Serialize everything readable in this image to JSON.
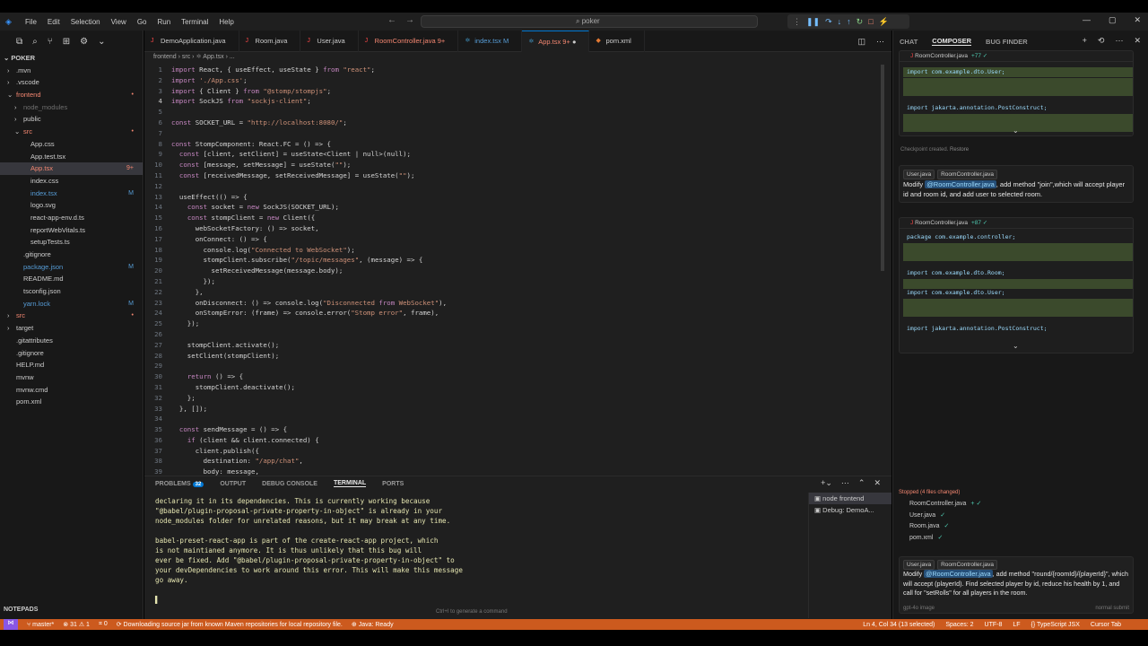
{
  "menu": [
    "File",
    "Edit",
    "Selection",
    "View",
    "Go",
    "Run",
    "Terminal",
    "Help"
  ],
  "search": {
    "value": "poker"
  },
  "explorer": {
    "root": "POKER",
    "items": [
      {
        "label": ".mvn",
        "indent": 1,
        "arrow": "›",
        "color": "#cccccc",
        "dec": ""
      },
      {
        "label": ".vscode",
        "indent": 1,
        "arrow": "›",
        "color": "#cccccc",
        "dec": ""
      },
      {
        "label": "frontend",
        "indent": 1,
        "arrow": "⌄",
        "color": "#f48771",
        "dec": "•"
      },
      {
        "label": "node_modules",
        "indent": 2,
        "arrow": "›",
        "color": "#6e6e6e",
        "dec": ""
      },
      {
        "label": "public",
        "indent": 2,
        "arrow": "›",
        "color": "#cccccc",
        "dec": ""
      },
      {
        "label": "src",
        "indent": 2,
        "arrow": "⌄",
        "color": "#f48771",
        "dec": "•"
      },
      {
        "label": "App.css",
        "indent": 3,
        "arrow": "",
        "color": "#cccccc",
        "dec": ""
      },
      {
        "label": "App.test.tsx",
        "indent": 3,
        "arrow": "",
        "color": "#cccccc",
        "dec": ""
      },
      {
        "label": "App.tsx",
        "indent": 3,
        "arrow": "",
        "color": "#f48771",
        "dec": "9+",
        "sel": true
      },
      {
        "label": "index.css",
        "indent": 3,
        "arrow": "",
        "color": "#cccccc",
        "dec": ""
      },
      {
        "label": "index.tsx",
        "indent": 3,
        "arrow": "",
        "color": "#569cd6",
        "dec": "M"
      },
      {
        "label": "logo.svg",
        "indent": 3,
        "arrow": "",
        "color": "#cccccc",
        "dec": ""
      },
      {
        "label": "react-app-env.d.ts",
        "indent": 3,
        "arrow": "",
        "color": "#cccccc",
        "dec": ""
      },
      {
        "label": "reportWebVitals.ts",
        "indent": 3,
        "arrow": "",
        "color": "#cccccc",
        "dec": ""
      },
      {
        "label": "setupTests.ts",
        "indent": 3,
        "arrow": "",
        "color": "#cccccc",
        "dec": ""
      },
      {
        "label": ".gitignore",
        "indent": 2,
        "arrow": "",
        "color": "#cccccc",
        "dec": ""
      },
      {
        "label": "package.json",
        "indent": 2,
        "arrow": "",
        "color": "#569cd6",
        "dec": "M"
      },
      {
        "label": "README.md",
        "indent": 2,
        "arrow": "",
        "color": "#cccccc",
        "dec": ""
      },
      {
        "label": "tsconfig.json",
        "indent": 2,
        "arrow": "",
        "color": "#cccccc",
        "dec": ""
      },
      {
        "label": "yarn.lock",
        "indent": 2,
        "arrow": "",
        "color": "#569cd6",
        "dec": "M"
      },
      {
        "label": "src",
        "indent": 1,
        "arrow": "›",
        "color": "#f48771",
        "dec": "•"
      },
      {
        "label": "target",
        "indent": 1,
        "arrow": "›",
        "color": "#cccccc",
        "dec": ""
      },
      {
        "label": ".gitattributes",
        "indent": 1,
        "arrow": "",
        "color": "#cccccc",
        "dec": ""
      },
      {
        "label": ".gitignore",
        "indent": 1,
        "arrow": "",
        "color": "#cccccc",
        "dec": ""
      },
      {
        "label": "HELP.md",
        "indent": 1,
        "arrow": "",
        "color": "#cccccc",
        "dec": ""
      },
      {
        "label": "mvnw",
        "indent": 1,
        "arrow": "",
        "color": "#cccccc",
        "dec": ""
      },
      {
        "label": "mvnw.cmd",
        "indent": 1,
        "arrow": "",
        "color": "#cccccc",
        "dec": ""
      },
      {
        "label": "pom.xml",
        "indent": 1,
        "arrow": "",
        "color": "#cccccc",
        "dec": ""
      }
    ],
    "notepads": "NOTEPADS"
  },
  "tabs": [
    {
      "label": "DemoApplication.java",
      "color": "#cccccc",
      "icon": "J",
      "iconColor": "#f44747",
      "active": false
    },
    {
      "label": "Room.java",
      "color": "#cccccc",
      "icon": "J",
      "iconColor": "#f44747",
      "active": false
    },
    {
      "label": "User.java",
      "color": "#cccccc",
      "icon": "J",
      "iconColor": "#f44747",
      "active": false
    },
    {
      "label": "RoomController.java 9+",
      "color": "#f48771",
      "icon": "J",
      "iconColor": "#f44747",
      "active": false
    },
    {
      "label": "index.tsx M",
      "color": "#569cd6",
      "icon": "⚛",
      "iconColor": "#4fc1ff",
      "active": false
    },
    {
      "label": "App.tsx 9+",
      "color": "#f48771",
      "icon": "⚛",
      "iconColor": "#4fc1ff",
      "active": true
    },
    {
      "label": "pom.xml",
      "color": "#cccccc",
      "icon": "◆",
      "iconColor": "#e37933",
      "active": false
    }
  ],
  "breadcrumb": "frontend  ›  src  ›  ⚛ App.tsx  ›  ...",
  "code": [
    {
      "n": "1",
      "t": "import React, { useEffect, useState } from \"react\";"
    },
    {
      "n": "2",
      "t": "import './App.css';"
    },
    {
      "n": "3",
      "t": "import { Client } from \"@stomp/stompjs\";"
    },
    {
      "n": "4",
      "t": "import SockJS from \"sockjs-client\";",
      "cur": true
    },
    {
      "n": "5",
      "t": ""
    },
    {
      "n": "6",
      "t": "const SOCKET_URL = \"http://localhost:8080/\";"
    },
    {
      "n": "7",
      "t": ""
    },
    {
      "n": "8",
      "t": "const StompComponent: React.FC = () => {"
    },
    {
      "n": "9",
      "t": "  const [client, setClient] = useState<Client | null>(null);"
    },
    {
      "n": "10",
      "t": "  const [message, setMessage] = useState(\"\");"
    },
    {
      "n": "11",
      "t": "  const [receivedMessage, setReceivedMessage] = useState(\"\");"
    },
    {
      "n": "12",
      "t": ""
    },
    {
      "n": "13",
      "t": "  useEffect(() => {"
    },
    {
      "n": "14",
      "t": "    const socket = new SockJS(SOCKET_URL);"
    },
    {
      "n": "15",
      "t": "    const stompClient = new Client({"
    },
    {
      "n": "16",
      "t": "      webSocketFactory: () => socket,"
    },
    {
      "n": "17",
      "t": "      onConnect: () => {"
    },
    {
      "n": "18",
      "t": "        console.log(\"Connected to WebSocket\");"
    },
    {
      "n": "19",
      "t": "        stompClient.subscribe(\"/topic/messages\", (message) => {"
    },
    {
      "n": "20",
      "t": "          setReceivedMessage(message.body);"
    },
    {
      "n": "21",
      "t": "        });"
    },
    {
      "n": "22",
      "t": "      },"
    },
    {
      "n": "23",
      "t": "      onDisconnect: () => console.log(\"Disconnected from WebSocket\"),"
    },
    {
      "n": "24",
      "t": "      onStompError: (frame) => console.error(\"Stomp error\", frame),"
    },
    {
      "n": "25",
      "t": "    });"
    },
    {
      "n": "26",
      "t": ""
    },
    {
      "n": "27",
      "t": "    stompClient.activate();"
    },
    {
      "n": "28",
      "t": "    setClient(stompClient);"
    },
    {
      "n": "29",
      "t": ""
    },
    {
      "n": "30",
      "t": "    return () => {"
    },
    {
      "n": "31",
      "t": "      stompClient.deactivate();"
    },
    {
      "n": "32",
      "t": "    };"
    },
    {
      "n": "33",
      "t": "  }, []);"
    },
    {
      "n": "34",
      "t": ""
    },
    {
      "n": "35",
      "t": "  const sendMessage = () => {"
    },
    {
      "n": "36",
      "t": "    if (client && client.connected) {"
    },
    {
      "n": "37",
      "t": "      client.publish({"
    },
    {
      "n": "38",
      "t": "        destination: \"/app/chat\","
    },
    {
      "n": "39",
      "t": "        body: message,"
    }
  ],
  "panel": {
    "tabs": [
      {
        "label": "PROBLEMS",
        "badge": "32"
      },
      {
        "label": "OUTPUT"
      },
      {
        "label": "DEBUG CONSOLE"
      },
      {
        "label": "TERMINAL",
        "on": true
      },
      {
        "label": "PORTS"
      }
    ],
    "terminal": [
      {
        "t": "declaring it in its dependencies. This is currently working because"
      },
      {
        "t": "\"@babel/plugin-proposal-private-property-in-object\" is already in your"
      },
      {
        "t": "node_modules folder for unrelated reasons, but it may break at any time."
      },
      {
        "t": ""
      },
      {
        "t": "babel-preset-react-app is part of the create-react-app project, which"
      },
      {
        "t": "is not maintianed anymore. It is thus unlikely that this bug will"
      },
      {
        "t": "ever be fixed. Add \"@babel/plugin-proposal-private-property-in-object\" to"
      },
      {
        "t": "your devDependencies to work around this error. This will make this message"
      },
      {
        "t": "go away."
      },
      {
        "t": ""
      },
      {
        "t": "▌"
      }
    ],
    "terminals": [
      {
        "label": "node  frontend",
        "sel": true
      },
      {
        "label": "Debug: DemoA..."
      }
    ],
    "hint": "Ctrl+I to generate a command"
  },
  "right": {
    "tabs": [
      {
        "label": "CHAT"
      },
      {
        "label": "COMPOSER",
        "on": true
      },
      {
        "label": "BUG FINDER"
      }
    ],
    "card1": {
      "file": "RoomController.java",
      "plus": "+77 ✓",
      "lines": [
        "import com.example.dto.User;",
        "import jakarta.annotation.PostConstruct;"
      ]
    },
    "checkpoint": "Checkpoint created.",
    "restore": "Restore",
    "msg1": {
      "chips": [
        "User.java",
        "RoomController.java"
      ],
      "pre": "Modify ",
      "mention": "@RoomController.java",
      "post": ", add method \"join\",which will accept player id and room id, and add user to selected room."
    },
    "card2": {
      "file": "RoomController.java",
      "plus": "+87 ✓",
      "lines": [
        "package com.example.controller;",
        "import com.example.dto.Room;",
        "import com.example.dto.User;",
        "import jakarta.annotation.PostConstruct;"
      ]
    },
    "stopped": "Stopped (4 files changed)",
    "files": [
      {
        "name": "RoomController.java",
        "meta": "+ ✓"
      },
      {
        "name": "User.java",
        "meta": "✓"
      },
      {
        "name": "Room.java",
        "meta": "✓"
      },
      {
        "name": "pom.xml",
        "meta": "✓"
      }
    ],
    "msg2": {
      "chips": [
        "User.java",
        "RoomController.java"
      ],
      "pre": "Modify ",
      "mention": "@RoomController.java",
      "post": ", add method \"round/{roomId}/{playerId}\", which will accept (playerId). Find selected player by id, reduce his health by 1, and call for \"setRolls\" for all players in the room."
    },
    "footer_left": "gpt-4o   image",
    "footer_right": "normal   submit"
  },
  "status": {
    "branch": "master*",
    "errors": "⊗ 31 ⚠ 1",
    "ports": "⌗ 0",
    "task": "Downloading source jar from known Maven repositories for local repository file.",
    "java": "Java: Ready",
    "right": [
      "Ln 4, Col 34 (13 selected)",
      "Spaces: 2",
      "UTF-8",
      "LF",
      "{} TypeScript JSX",
      "Cursor Tab"
    ]
  }
}
